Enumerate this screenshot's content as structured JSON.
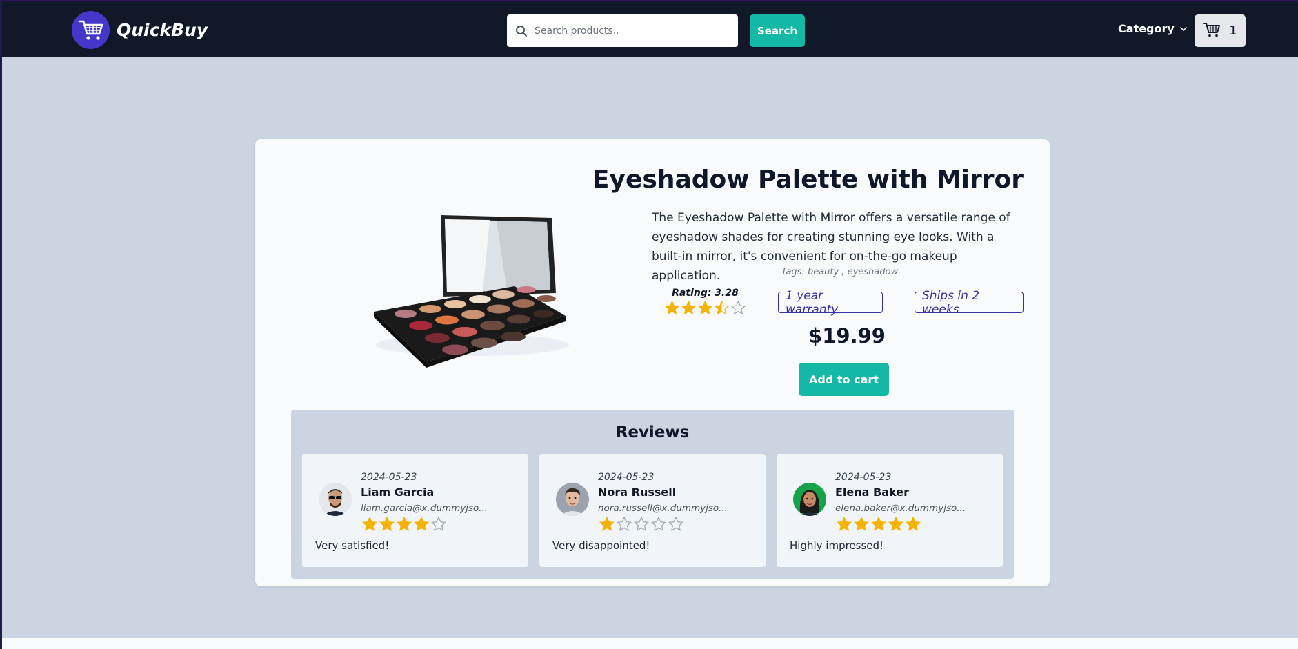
{
  "header": {
    "brand": "QuickBuy",
    "search_placeholder": "Search products..",
    "search_button": "Search",
    "category_label": "Category",
    "cart_count": "1"
  },
  "product": {
    "title": "Eyeshadow Palette with Mirror",
    "description": "The Eyeshadow Palette with Mirror offers a versatile range of eyeshadow shades for creating stunning eye looks. With a built-in mirror, it's convenient for on-the-go makeup application.",
    "tags_text": "Tags: beauty , eyeshadow",
    "rating_text": "Rating: 3.28",
    "rating": 3.28,
    "warranty": "1 year warranty",
    "shipping": "Ships in 2 weeks",
    "price": "$19.99",
    "add_to_cart": "Add to cart"
  },
  "reviews": {
    "title": "Reviews",
    "items": [
      {
        "date": "2024-05-23",
        "name": "Liam Garcia",
        "email": "liam.garcia@x.dummyjso...",
        "rating": 4,
        "comment": "Very satisfied!"
      },
      {
        "date": "2024-05-23",
        "name": "Nora Russell",
        "email": "nora.russell@x.dummyjso...",
        "rating": 1,
        "comment": "Very disappointed!"
      },
      {
        "date": "2024-05-23",
        "name": "Elena Baker",
        "email": "elena.baker@x.dummyjso...",
        "rating": 5,
        "comment": "Highly impressed!"
      }
    ]
  },
  "colors": {
    "nav_bg": "#111827",
    "brand_circle": "#4338ca",
    "accent": "#14b8a6",
    "star": "#f5b301",
    "badge": "#3730a3",
    "page_bg": "#cbd5e1"
  },
  "icons": [
    "cart-icon",
    "search-icon",
    "chevron-down-icon",
    "star-icon"
  ]
}
